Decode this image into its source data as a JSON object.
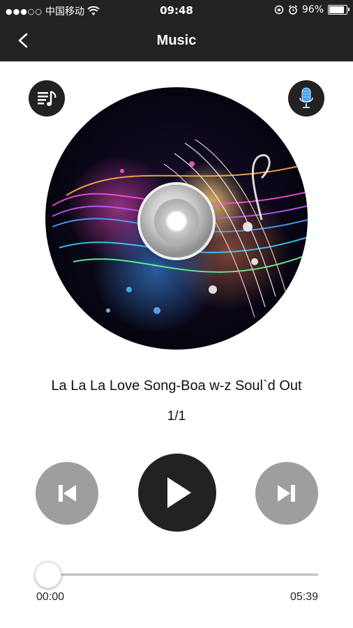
{
  "status_bar": {
    "carrier": "中国移动",
    "time": "09:48",
    "battery_percent": "96%",
    "battery_level": 0.96
  },
  "nav": {
    "title": "Music",
    "back_icon": "chevron-left-icon"
  },
  "buttons": {
    "playlist_icon": "playlist-icon",
    "mic_icon": "microphone-icon"
  },
  "track": {
    "title": "La La La Love Song-Boa w-z Soul`d Out",
    "position": "1/1"
  },
  "controls": {
    "prev_icon": "skip-previous-icon",
    "play_icon": "play-icon",
    "next_icon": "skip-next-icon"
  },
  "progress": {
    "current": "00:00",
    "total": "05:39",
    "fraction": 0
  },
  "colors": {
    "bar_bg": "#222222",
    "control_gray": "#9e9e9e",
    "play_bg": "#222222"
  }
}
